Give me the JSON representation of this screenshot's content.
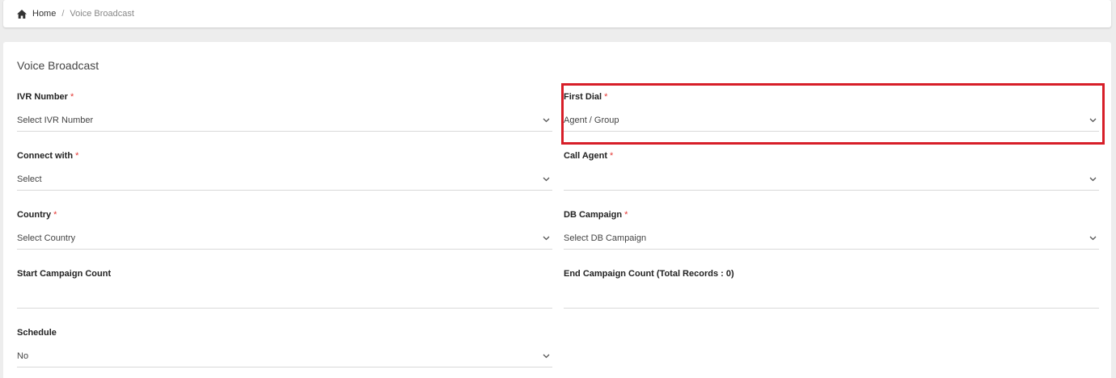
{
  "breadcrumb": {
    "home_label": "Home",
    "separator": "/",
    "current": "Voice Broadcast"
  },
  "card": {
    "title": "Voice Broadcast"
  },
  "fields": {
    "ivr_number": {
      "label": "IVR Number",
      "required": "*",
      "value": "Select IVR Number"
    },
    "first_dial": {
      "label": "First Dial",
      "required": "*",
      "value": "Agent / Group"
    },
    "connect_with": {
      "label": "Connect with",
      "required": "*",
      "value": "Select"
    },
    "call_agent": {
      "label": "Call Agent",
      "required": "*",
      "value": ""
    },
    "country": {
      "label": "Country",
      "required": "*",
      "value": "Select Country"
    },
    "db_campaign": {
      "label": "DB Campaign",
      "required": "*",
      "value": "Select DB Campaign"
    },
    "start_campaign_count": {
      "label": "Start Campaign Count",
      "value": ""
    },
    "end_campaign_count": {
      "label": "End Campaign Count (Total Records : 0)",
      "value": ""
    },
    "schedule": {
      "label": "Schedule",
      "value": "No"
    }
  },
  "colors": {
    "required": "#e53935",
    "highlight": "#d71e28"
  }
}
